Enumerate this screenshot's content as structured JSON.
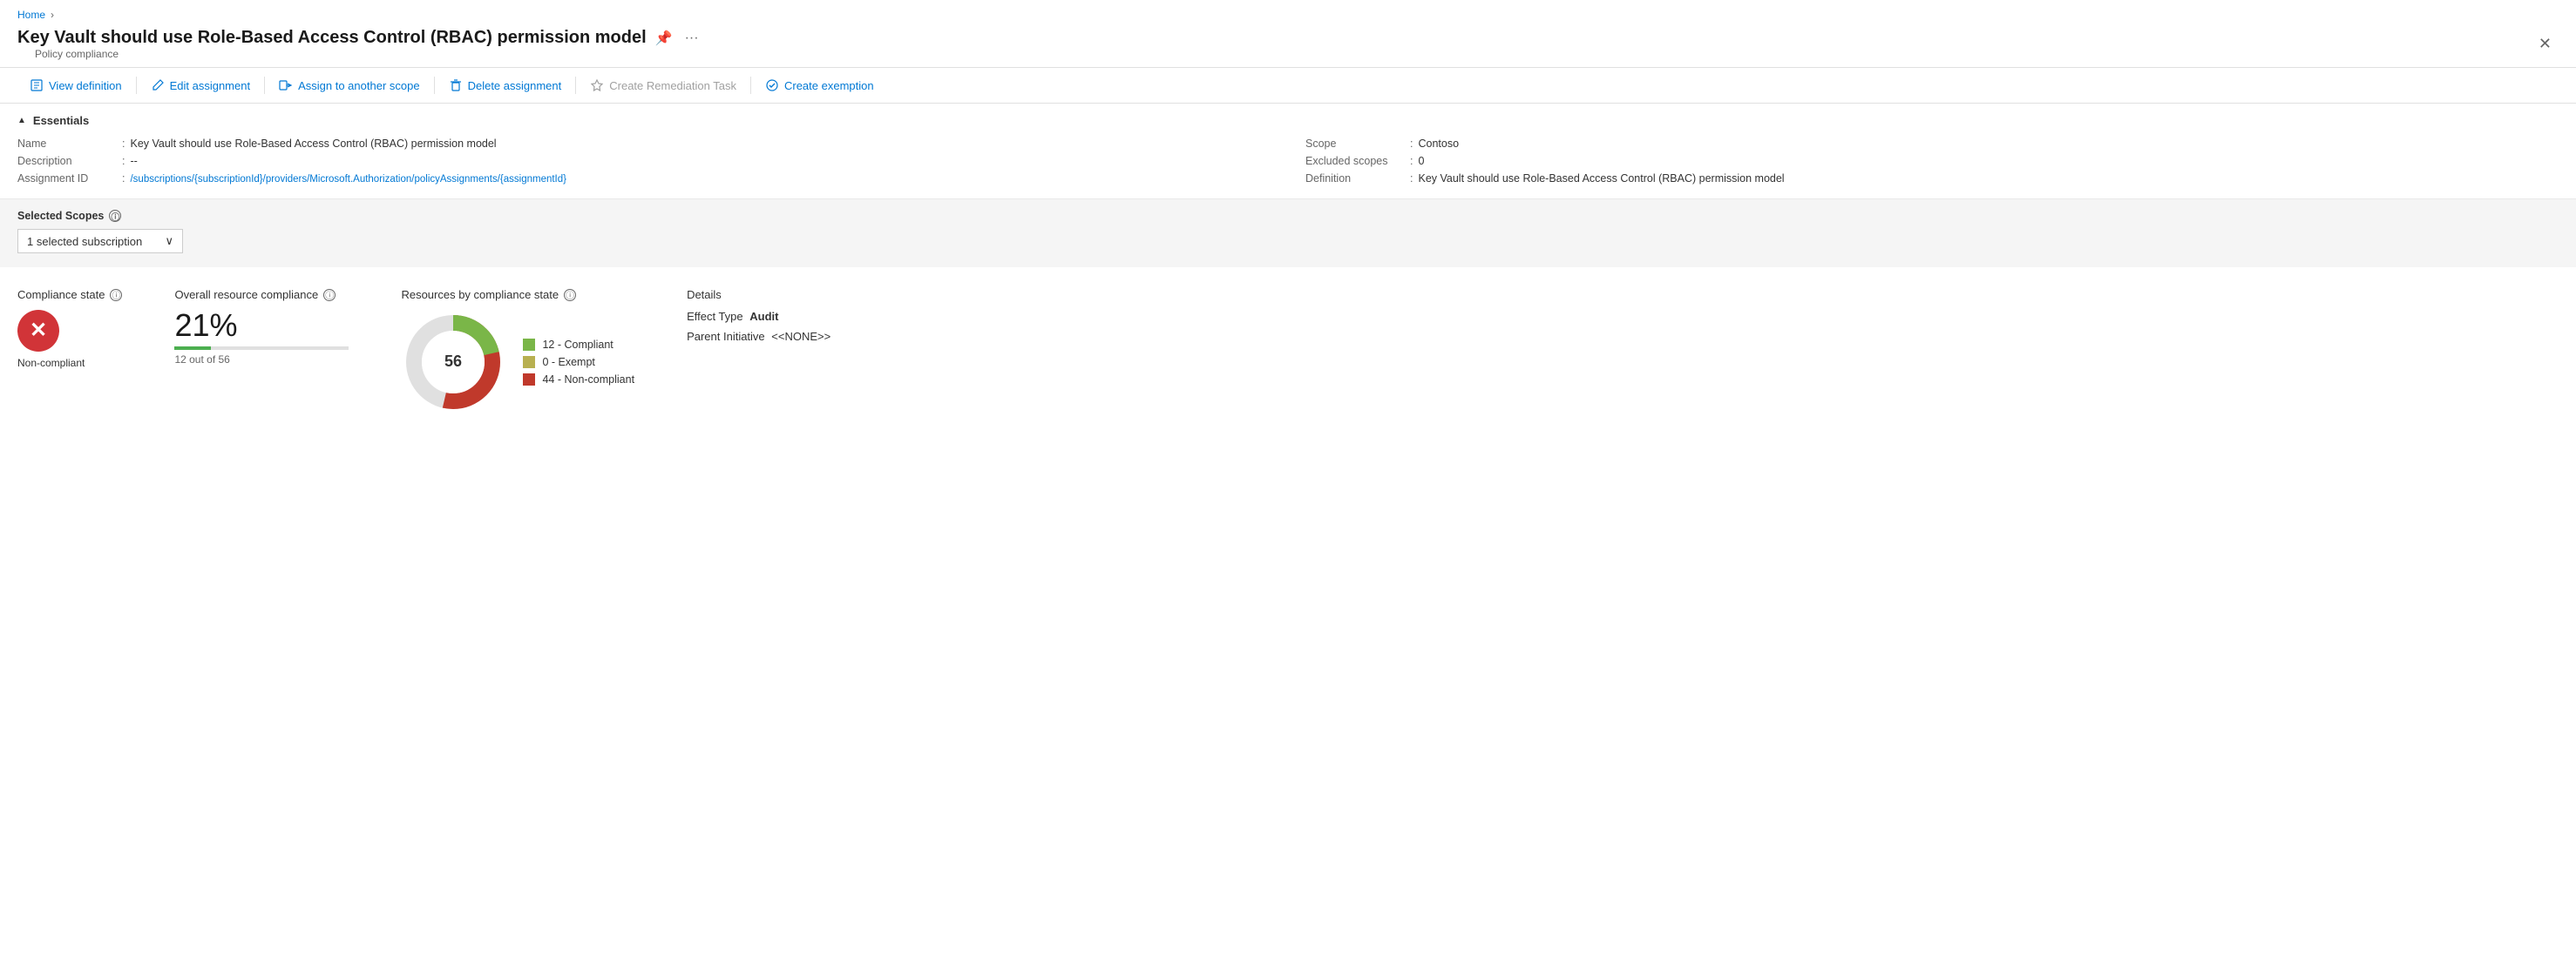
{
  "breadcrumb": {
    "home": "Home"
  },
  "page": {
    "title": "Key Vault should use Role-Based Access Control (RBAC) permission model",
    "subtitle": "Policy compliance",
    "pin_icon": "📌",
    "more_icon": "…"
  },
  "toolbar": {
    "view_definition": "View definition",
    "edit_assignment": "Edit assignment",
    "assign_to_scope": "Assign to another scope",
    "delete_assignment": "Delete assignment",
    "create_remediation": "Create Remediation Task",
    "create_exemption": "Create exemption"
  },
  "essentials": {
    "header": "Essentials",
    "name_label": "Name",
    "name_value": "Key Vault should use Role-Based Access Control (RBAC) permission model",
    "description_label": "Description",
    "description_value": "--",
    "assignment_id_label": "Assignment ID",
    "assignment_id_value": "/subscriptions/{subscriptionId}/providers/Microsoft.Authorization/policyAssignments/{assignmentId}",
    "scope_label": "Scope",
    "scope_value": "Contoso",
    "excluded_scopes_label": "Excluded scopes",
    "excluded_scopes_value": "0",
    "definition_label": "Definition",
    "definition_value": "Key Vault should use Role-Based Access Control (RBAC) permission model"
  },
  "scopes": {
    "label": "Selected Scopes",
    "dropdown_value": "1 selected subscription"
  },
  "compliance_state": {
    "title": "Compliance state",
    "state": "Non-compliant"
  },
  "overall_compliance": {
    "title": "Overall resource compliance",
    "percent": "21%",
    "detail": "12 out of 56",
    "bar_percent": 21
  },
  "resources_by_state": {
    "title": "Resources by compliance state",
    "total": "56",
    "legend": [
      {
        "label": "12 - Compliant",
        "color": "#7ab648"
      },
      {
        "label": "0 - Exempt",
        "color": "#b8b050"
      },
      {
        "label": "44 - Non-compliant",
        "color": "#c0392b"
      }
    ],
    "donut": {
      "compliant": 12,
      "exempt": 0,
      "non_compliant": 44,
      "total": 56
    }
  },
  "details": {
    "title": "Details",
    "effect_type_label": "Effect Type",
    "effect_type_value": "Audit",
    "parent_initiative_label": "Parent Initiative",
    "parent_initiative_value": "<<NONE>>"
  }
}
